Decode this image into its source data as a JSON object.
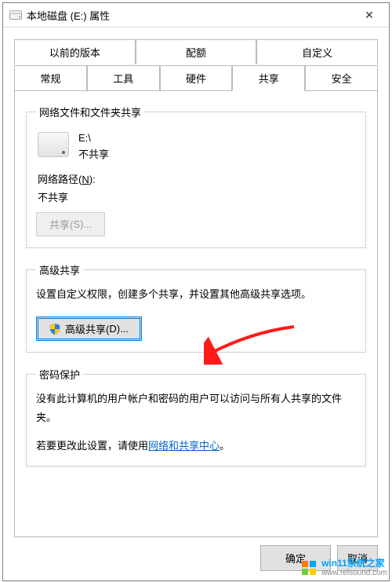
{
  "window": {
    "title": "本地磁盘 (E:) 属性",
    "close_glyph": "✕"
  },
  "tabs": {
    "row1": [
      "以前的版本",
      "配额",
      "自定义"
    ],
    "row2": [
      "常规",
      "工具",
      "硬件",
      "共享",
      "安全"
    ],
    "active": "共享"
  },
  "group1": {
    "legend": "网络文件和文件夹共享",
    "path": "E:\\",
    "status": "不共享",
    "netpath_label_prefix": "网络路径(",
    "netpath_label_key": "N",
    "netpath_label_suffix": "):",
    "netpath_value": "不共享",
    "share_btn_prefix": "共享(",
    "share_btn_key": "S",
    "share_btn_suffix": ")...",
    "share_btn_enabled": false
  },
  "group2": {
    "legend": "高级共享",
    "desc": "设置自定义权限，创建多个共享，并设置其他高级共享选项。",
    "adv_btn_prefix": "高级共享(",
    "adv_btn_key": "D",
    "adv_btn_suffix": ")..."
  },
  "group3": {
    "legend": "密码保护",
    "line1": "没有此计算机的用户帐户和密码的用户可以访问与所有人共享的文件夹。",
    "line2_prefix": "若要更改此设置，请使用",
    "line2_link": "网络和共享中心",
    "line2_suffix": "。"
  },
  "buttons": {
    "ok": "确定",
    "cancel": "取消"
  },
  "watermark": {
    "brand": "win11系统之家",
    "url": "www.relsound.com"
  }
}
